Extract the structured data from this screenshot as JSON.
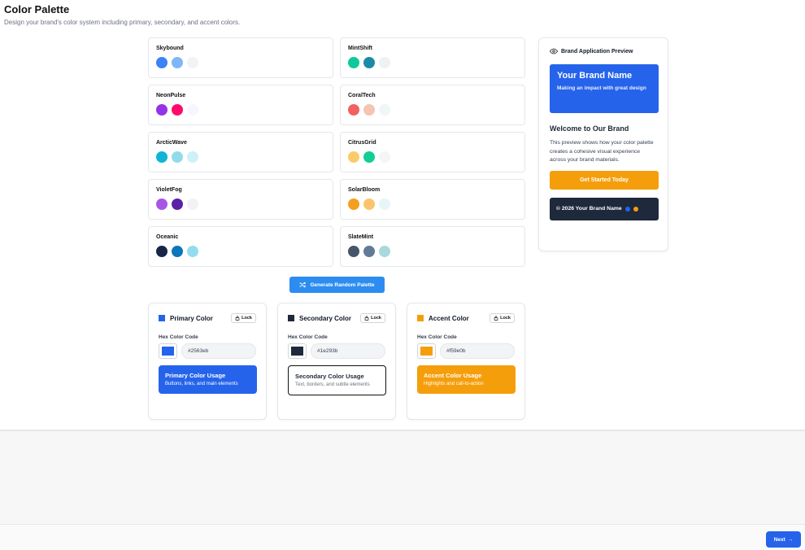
{
  "header": {
    "title": "Color Palette",
    "subtitle": "Design your brand's color system including primary, secondary, and accent colors."
  },
  "palettes": [
    {
      "name": "Skybound",
      "colors": [
        "#3b82f6",
        "#7fb6f8",
        "#f1f3f5"
      ]
    },
    {
      "name": "MintShift",
      "colors": [
        "#10c99a",
        "#1b8aa6",
        "#eef2f4"
      ]
    },
    {
      "name": "NeonPulse",
      "colors": [
        "#9333ea",
        "#ff0a6c",
        "#f8f5ff"
      ]
    },
    {
      "name": "CoralTech",
      "colors": [
        "#f26060",
        "#f5c4b3",
        "#f0f6f8"
      ]
    },
    {
      "name": "ArcticWave",
      "colors": [
        "#11b4d4",
        "#93dbeb",
        "#cdf1f6"
      ]
    },
    {
      "name": "CitrusGrid",
      "colors": [
        "#fbcb69",
        "#12ce94",
        "#f3f5f6"
      ]
    },
    {
      "name": "VioletFog",
      "colors": [
        "#a855e6",
        "#5b21a6",
        "#f1f2f4"
      ]
    },
    {
      "name": "SolarBloom",
      "colors": [
        "#f69e1f",
        "#fcc46c",
        "#e6f6f6"
      ]
    },
    {
      "name": "Oceanic",
      "colors": [
        "#172648",
        "#0e76ba",
        "#93dcee"
      ]
    },
    {
      "name": "SlateMint",
      "colors": [
        "#475569",
        "#617b96",
        "#a9d9da"
      ]
    }
  ],
  "generate_button": {
    "label": "Generate Random Palette"
  },
  "color_cards": [
    {
      "title": "Primary Color",
      "lock": "Lock",
      "hex_label": "Hex Color Code",
      "hex": "#2563eb",
      "color": "#2563eb",
      "usage_title": "Primary Color Usage",
      "usage_desc": "Buttons, links, and main elements"
    },
    {
      "title": "Secondary Color",
      "lock": "Lock",
      "hex_label": "Hex Color Code",
      "hex": "#1e293b",
      "color": "#1e293b",
      "usage_title": "Secondary Color Usage",
      "usage_desc": "Text, borders, and subtle elements"
    },
    {
      "title": "Accent Color",
      "lock": "Lock",
      "hex_label": "Hex Color Code",
      "hex": "#f59e0b",
      "color": "#f59e0b",
      "usage_title": "Accent Color Usage",
      "usage_desc": "Highlights and call-to-action"
    }
  ],
  "preview": {
    "title": "Brand Application Preview",
    "brand_name": "Your Brand Name",
    "tagline": "Making an impact with great design",
    "welcome": "Welcome to Our Brand",
    "description": "This preview shows how your color palette creates a cohesive visual experience across your brand materials.",
    "cta": "Get Started Today",
    "footer": "© 2026 Your Brand Name"
  },
  "footer_nav": {
    "next_label": "Next"
  }
}
